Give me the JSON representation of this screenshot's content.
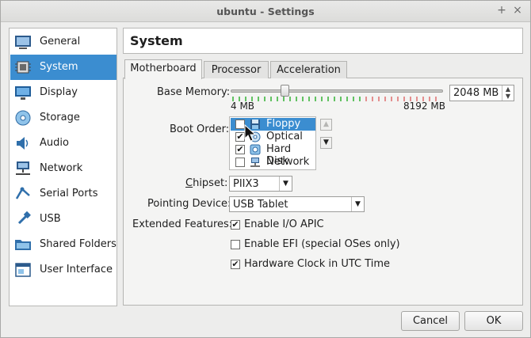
{
  "window": {
    "title": "ubuntu - Settings",
    "pin_glyph": "+",
    "close_glyph": "×"
  },
  "sidebar": {
    "items": [
      {
        "label": "General",
        "icon": "general-icon"
      },
      {
        "label": "System",
        "icon": "chip-icon",
        "selected": true
      },
      {
        "label": "Display",
        "icon": "monitor-icon"
      },
      {
        "label": "Storage",
        "icon": "disk-icon"
      },
      {
        "label": "Audio",
        "icon": "speaker-icon"
      },
      {
        "label": "Network",
        "icon": "network-icon"
      },
      {
        "label": "Serial Ports",
        "icon": "serial-port-icon"
      },
      {
        "label": "USB",
        "icon": "usb-icon"
      },
      {
        "label": "Shared Folders",
        "icon": "folder-icon"
      },
      {
        "label": "User Interface",
        "icon": "user-interface-icon"
      }
    ]
  },
  "header": {
    "title": "System"
  },
  "tabs": [
    {
      "label": "Motherboard",
      "active": true
    },
    {
      "label": "Processor",
      "active": false
    },
    {
      "label": "Acceleration",
      "active": false
    }
  ],
  "motherboard": {
    "base_memory": {
      "label": "Base Memory:",
      "value": "2048 MB",
      "value_mb": 2048,
      "min_label": "4 MB",
      "max_label": "8192 MB",
      "min_mb": 4,
      "max_mb": 8192
    },
    "boot_order": {
      "label": "Boot Order:",
      "items": [
        {
          "label": "Floppy",
          "checked": false,
          "selected": true,
          "icon": "floppy-icon"
        },
        {
          "label": "Optical",
          "checked": true,
          "selected": false,
          "icon": "optical-disc-icon"
        },
        {
          "label": "Hard Disk",
          "checked": true,
          "selected": false,
          "icon": "hard-disk-icon"
        },
        {
          "label": "Network",
          "checked": false,
          "selected": false,
          "icon": "network-icon"
        }
      ],
      "up_glyph": "▲",
      "down_glyph": "▼"
    },
    "chipset": {
      "label": "Chipset:",
      "value": "PIIX3"
    },
    "pointing_device": {
      "label": "Pointing Device:",
      "value": "USB Tablet"
    },
    "extended_features": {
      "label": "Extended Features:",
      "options": [
        {
          "label": "Enable I/O APIC",
          "checked": true
        },
        {
          "label": "Enable EFI (special OSes only)",
          "checked": false
        },
        {
          "label": "Hardware Clock in UTC Time",
          "checked": true
        }
      ]
    }
  },
  "buttons": {
    "cancel": "Cancel",
    "ok": "OK"
  },
  "glyphs": {
    "check": "✔",
    "combo_arrow": "▼"
  },
  "colors": {
    "selection": "#3b8dd0",
    "memory_safe": "#62c262",
    "memory_warn": "#e48f8f"
  }
}
